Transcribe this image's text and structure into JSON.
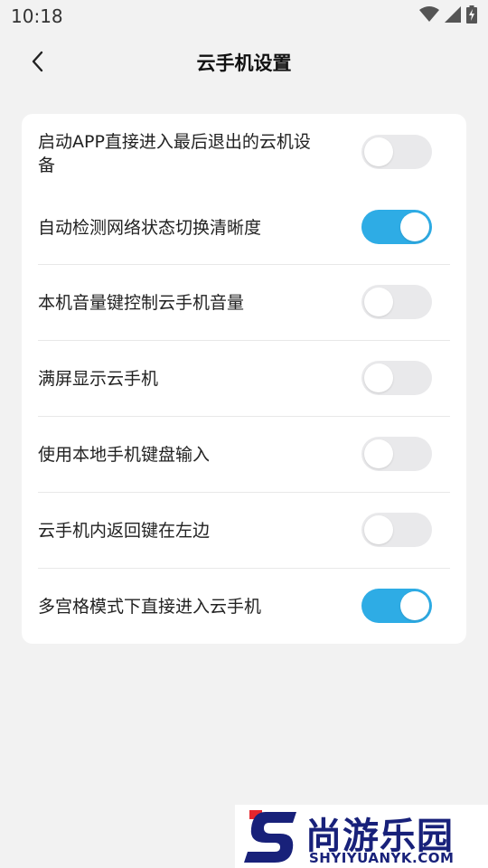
{
  "status_bar": {
    "time": "10:18",
    "icons": [
      "wifi-icon",
      "cellular-signal-icon",
      "battery-charging-icon"
    ]
  },
  "header": {
    "title": "云手机设置",
    "back_icon": "chevron-left-icon"
  },
  "settings": [
    {
      "label_line1": "启动APP直接进入最后退出的云机设",
      "label_line2": "备",
      "enabled": false
    },
    {
      "label": "自动检测网络状态切换清晰度",
      "enabled": true
    },
    {
      "label": "本机音量键控制云手机音量",
      "enabled": false
    },
    {
      "label": "满屏显示云手机",
      "enabled": false
    },
    {
      "label": "使用本地手机键盘输入",
      "enabled": false
    },
    {
      "label": "云手机内返回键在左边",
      "enabled": false
    },
    {
      "label": "多宫格模式下直接进入云手机",
      "enabled": true
    }
  ],
  "watermark": {
    "text": "尚游乐园",
    "subtext": "SHYIYUANYK.COM"
  },
  "colors": {
    "background": "#f2f2f2",
    "card": "#ffffff",
    "toggle_on": "#2eace5",
    "toggle_off": "#e9e9eb",
    "watermark_blue": "#18217a",
    "watermark_red": "#e5262d"
  }
}
